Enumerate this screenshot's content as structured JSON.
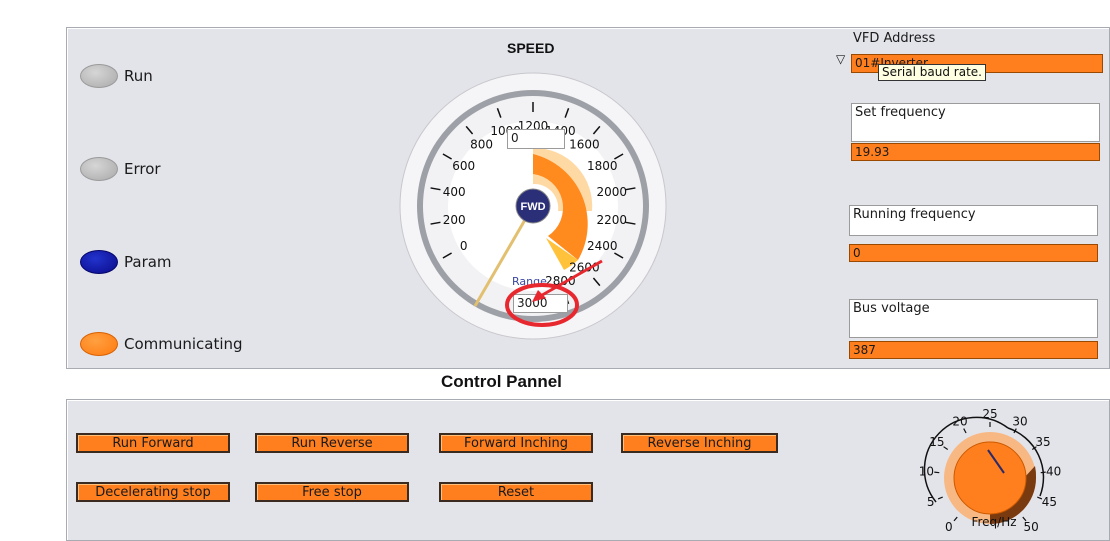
{
  "status": {
    "run_label": "Run",
    "error_label": "Error",
    "param_label": "Param",
    "communicating_label": "Communicating"
  },
  "speed": {
    "title": "SPEED",
    "value_display": "0",
    "direction_label": "FWD",
    "range_label": "Range",
    "range_value": "3000",
    "needle_value": 0,
    "scale_labels": [
      "0",
      "200",
      "400",
      "600",
      "800",
      "1000",
      "1200",
      "1400",
      "1600",
      "1800",
      "2000",
      "2200",
      "2400",
      "2600",
      "2800",
      "3000"
    ]
  },
  "right": {
    "vfd_address_label": "VFD Address",
    "vfd_address_value": "01#Inverter",
    "tooltip": "Serial baud rate.",
    "set_frequency_label": "Set frequency",
    "set_frequency_value": "19.93",
    "running_frequency_label": "Running frequency",
    "running_frequency_value": "0",
    "bus_voltage_label": "Bus voltage",
    "bus_voltage_value": "387"
  },
  "control": {
    "title": "Control Pannel",
    "buttons": {
      "run_forward": "Run Forward",
      "run_reverse": "Run Reverse",
      "forward_inching": "Forward  Inching",
      "reverse_inching": "Reverse  Inching",
      "decelerating_stop": "Decelerating stop",
      "free_stop": "Free stop",
      "reset": "Reset"
    }
  },
  "knob": {
    "unit_label": "Freq/Hz",
    "scale_labels": [
      "0",
      "5",
      "10",
      "15",
      "20",
      "25",
      "30",
      "35",
      "40",
      "45",
      "50"
    ],
    "value": 20
  },
  "colors": {
    "panel_bg": "#e3e4ea",
    "accent_orange": "#ff7f1e",
    "led_blue": "#0a0a8a",
    "annotation_red": "#e8282f"
  }
}
